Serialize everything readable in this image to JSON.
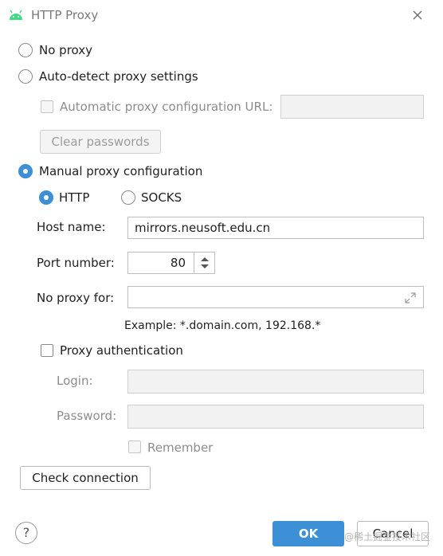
{
  "window": {
    "title": "HTTP Proxy",
    "icon": "android-icon",
    "close_icon": "close-icon"
  },
  "proxy_mode": {
    "no_proxy": "No proxy",
    "auto_detect": "Auto-detect proxy settings",
    "auto_url_label": "Automatic proxy configuration URL:",
    "auto_url_value": "",
    "clear_passwords": "Clear passwords",
    "manual": "Manual proxy configuration",
    "selected": "manual"
  },
  "manual": {
    "type_http": "HTTP",
    "type_socks": "SOCKS",
    "type_selected": "HTTP",
    "host_label": "Host name:",
    "host_value": "mirrors.neusoft.edu.cn",
    "port_label": "Port number:",
    "port_value": "80",
    "no_proxy_label": "No proxy for:",
    "no_proxy_value": "",
    "example": "Example: *.domain.com, 192.168.*"
  },
  "auth": {
    "label": "Proxy authentication",
    "checked": false,
    "login_label": "Login:",
    "login_value": "",
    "password_label": "Password:",
    "password_value": "",
    "remember": "Remember"
  },
  "footer": {
    "check_connection": "Check connection",
    "help": "?",
    "ok": "OK",
    "cancel": "Cancel",
    "watermark": "@稀土掘金技术社区"
  },
  "colors": {
    "accent": "#3d8fd6",
    "android_green": "#3ddc84"
  }
}
